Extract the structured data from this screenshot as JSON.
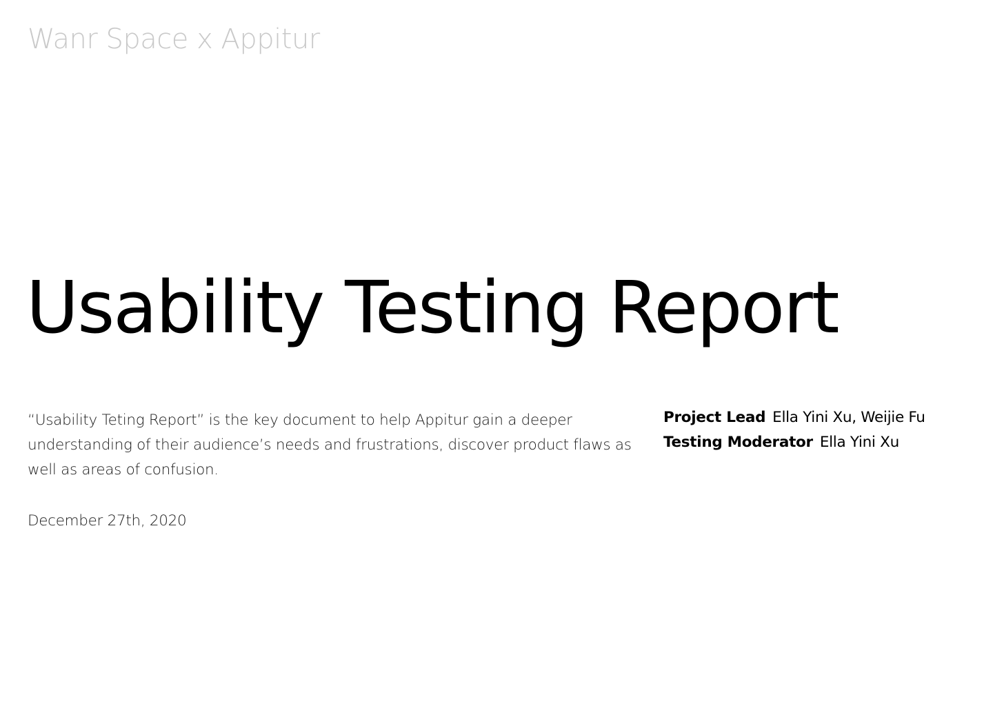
{
  "header": {
    "brand": "Wanr Space x Appitur"
  },
  "main": {
    "title": "Usability Testing Report",
    "description": "“Usability Teting Report” is the key document to help Appitur gain a deeper understanding of their audience’s needs and frustrations, discover product flaws as well as areas of confusion.",
    "date": "December 27th, 2020"
  },
  "credits": [
    {
      "label": "Project Lead",
      "value": "Ella Yini Xu, Weijie Fu"
    },
    {
      "label": "Testing Moderator",
      "value": "Ella Yini Xu"
    }
  ],
  "colors": {
    "brand_text": "#c9c9c9",
    "body_text": "#1a1a1a",
    "title_text": "#000000",
    "background": "#ffffff"
  }
}
